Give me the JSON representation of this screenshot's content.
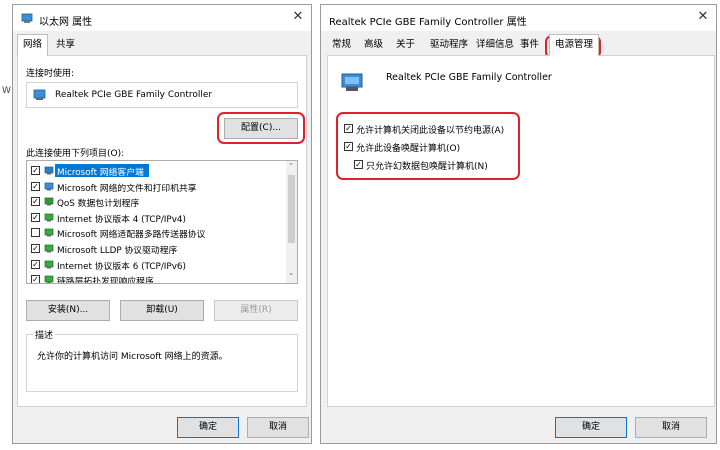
{
  "win1": {
    "title": "以太网 属性",
    "tabs": [
      "网络",
      "共享"
    ],
    "connect_using_label": "连接时使用:",
    "adapter": "Realtek PCIe GBE Family Controller",
    "configure_btn": "配置(C)...",
    "items_label": "此连接使用下列项目(O):",
    "items": [
      {
        "label": "Microsoft 网络客户端",
        "checked": true,
        "icon": "network-client-icon"
      },
      {
        "label": "Microsoft 网络的文件和打印机共享",
        "checked": true,
        "icon": "file-share-icon"
      },
      {
        "label": "QoS 数据包计划程序",
        "checked": true,
        "icon": "qos-icon"
      },
      {
        "label": "Internet 协议版本 4 (TCP/IPv4)",
        "checked": true,
        "icon": "protocol-icon"
      },
      {
        "label": "Microsoft 网络适配器多路传送器协议",
        "checked": false,
        "icon": "protocol-icon"
      },
      {
        "label": "Microsoft LLDP 协议驱动程序",
        "checked": true,
        "icon": "protocol-icon"
      },
      {
        "label": "Internet 协议版本 6 (TCP/IPv6)",
        "checked": true,
        "icon": "protocol-icon"
      },
      {
        "label": "链路层拓扑发现响应程序",
        "checked": true,
        "icon": "protocol-icon"
      }
    ],
    "install_btn": "安装(N)...",
    "uninstall_btn": "卸载(U)",
    "properties_btn": "属性(R)",
    "description_title": "描述",
    "description": "允许你的计算机访问 Microsoft 网络上的资源。",
    "ok_btn": "确定",
    "cancel_btn": "取消"
  },
  "win2": {
    "title": "Realtek PCIe GBE Family Controller 属性",
    "tabs": [
      "常规",
      "高级",
      "关于",
      "驱动程序",
      "详细信息",
      "事件",
      "电源管理"
    ],
    "device_name": "Realtek PCIe GBE Family Controller",
    "options": [
      {
        "label": "允许计算机关闭此设备以节约电源(A)",
        "checked": true
      },
      {
        "label": "允许此设备唤醒计算机(O)",
        "checked": true
      },
      {
        "label": "只允许幻数据包唤醒计算机(N)",
        "checked": true
      }
    ],
    "ok_btn": "确定",
    "cancel_btn": "取消"
  },
  "colors": {
    "highlight": "#0078d7",
    "annotation_red": "#e0202a",
    "window_bg": "#f0f0f0"
  }
}
